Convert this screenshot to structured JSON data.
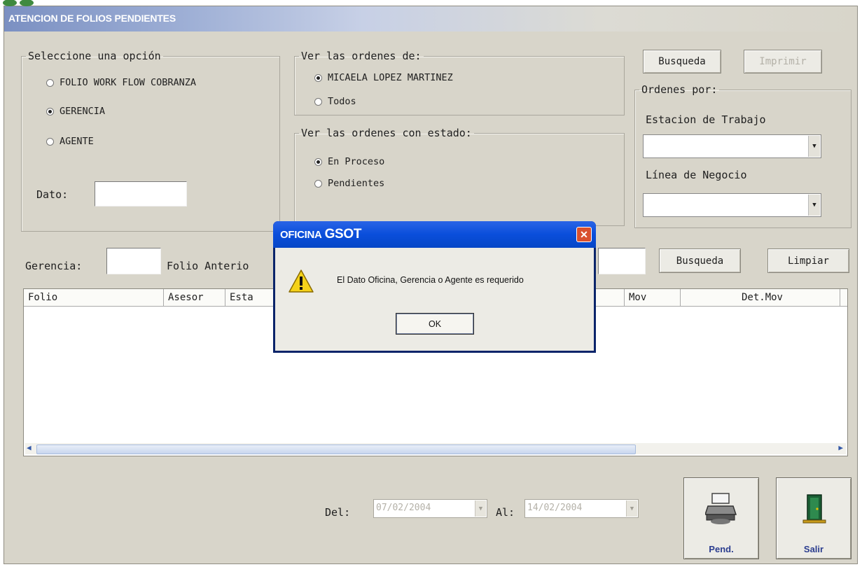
{
  "window": {
    "title": "ATENCION DE FOLIOS PENDIENTES"
  },
  "options_group": {
    "legend": "Seleccione una opción",
    "options": [
      "FOLIO WORK FLOW COBRANZA",
      "GERENCIA",
      "AGENTE"
    ],
    "selected": "GERENCIA",
    "dato_label": "Dato:",
    "dato_value": ""
  },
  "ver_ordenes_de": {
    "legend": "Ver las ordenes de:",
    "options": [
      "MICAELA LOPEZ MARTINEZ",
      "Todos"
    ],
    "selected": "MICAELA LOPEZ MARTINEZ"
  },
  "ver_estado": {
    "legend": "Ver las ordenes con estado:",
    "options": [
      "En Proceso",
      "Pendientes"
    ],
    "selected": "En Proceso"
  },
  "toolbar": {
    "busqueda": "Busqueda",
    "imprimir": "Imprimir"
  },
  "ordenes_por": {
    "legend": "Ordenes por:",
    "estacion_label": "Estacion de Trabajo",
    "estacion_value": "",
    "linea_label": "Línea de Negocio",
    "linea_value": ""
  },
  "filter_row": {
    "gerencia_label": "Gerencia:",
    "gerencia_value": "",
    "folio_anterior_label": "Folio Anterio",
    "busqueda": "Busqueda",
    "limpiar": "Limpiar"
  },
  "grid": {
    "columns": [
      "Folio",
      "Asesor",
      "Esta",
      "Mov",
      "Det.Mov"
    ],
    "rows": []
  },
  "dates": {
    "del_label": "Del:",
    "del_value": "07/02/2004",
    "al_label": "Al:",
    "al_value": "14/02/2004"
  },
  "actions": {
    "pend": "Pend.",
    "salir": "Salir"
  },
  "dialog": {
    "title_prefix": "OFICINA",
    "title_main": "GSOT",
    "close": "✕",
    "message": "El Dato Oficina, Gerencia o Agente es requerido",
    "ok": "OK"
  },
  "colors": {
    "window_bg": "#d8d5ca",
    "dialog_title": "#0a4edb",
    "action_caption": "#2b3d8f"
  }
}
